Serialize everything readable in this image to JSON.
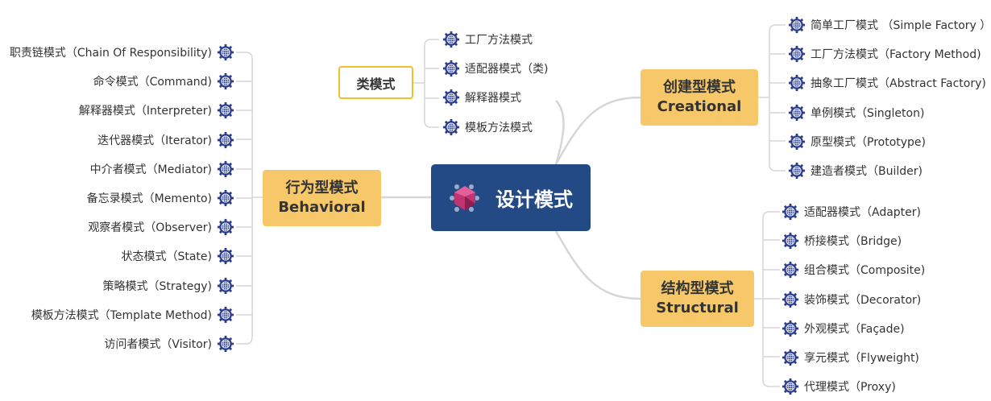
{
  "central": {
    "title": "设计模式",
    "icon": "gem-icon"
  },
  "class_patterns": {
    "label": "类模式",
    "items": [
      "工厂方法模式",
      "适配器模式（类)",
      "解释器模式",
      "模板方法模式"
    ]
  },
  "creational": {
    "label_cn": "创建型模式",
    "label_en": "Creational",
    "items": [
      "简单工厂模式 （Simple Factory ）",
      "工厂方法模式（Factory Method)",
      "抽象工厂模式（Abstract  Factory)",
      "单例模式（Singleton)",
      "原型模式（Prototype)",
      "建造者模式（Builder)"
    ]
  },
  "structural": {
    "label_cn": "结构型模式",
    "label_en": "Structural",
    "items": [
      "适配器模式（Adapter)",
      "桥接模式（Bridge)",
      "组合模式（Composite)",
      "装饰模式（Decorator)",
      "外观模式（Façade)",
      "享元模式（Flyweight)",
      "代理模式（Proxy)"
    ]
  },
  "behavioral": {
    "label_cn": "行为型模式",
    "label_en": "Behavioral",
    "items": [
      "职责链模式（Chain Of Responsibility)",
      "命令模式（Command)",
      "解释器模式（Interpreter)",
      "迭代器模式（Iterator)",
      "中介者模式（Mediator)",
      "备忘录模式（Memento)",
      "观察者模式（Observer)",
      "状态模式（State)",
      "策略模式（Strategy)",
      "模板方法模式（Template  Method)",
      "访问者模式（Visitor)"
    ]
  },
  "colors": {
    "central": "#234a85",
    "topic": "#f6c86a",
    "class_border": "#f2c02f",
    "icon": "#2b3d8f",
    "line": "#d6d6d6"
  }
}
